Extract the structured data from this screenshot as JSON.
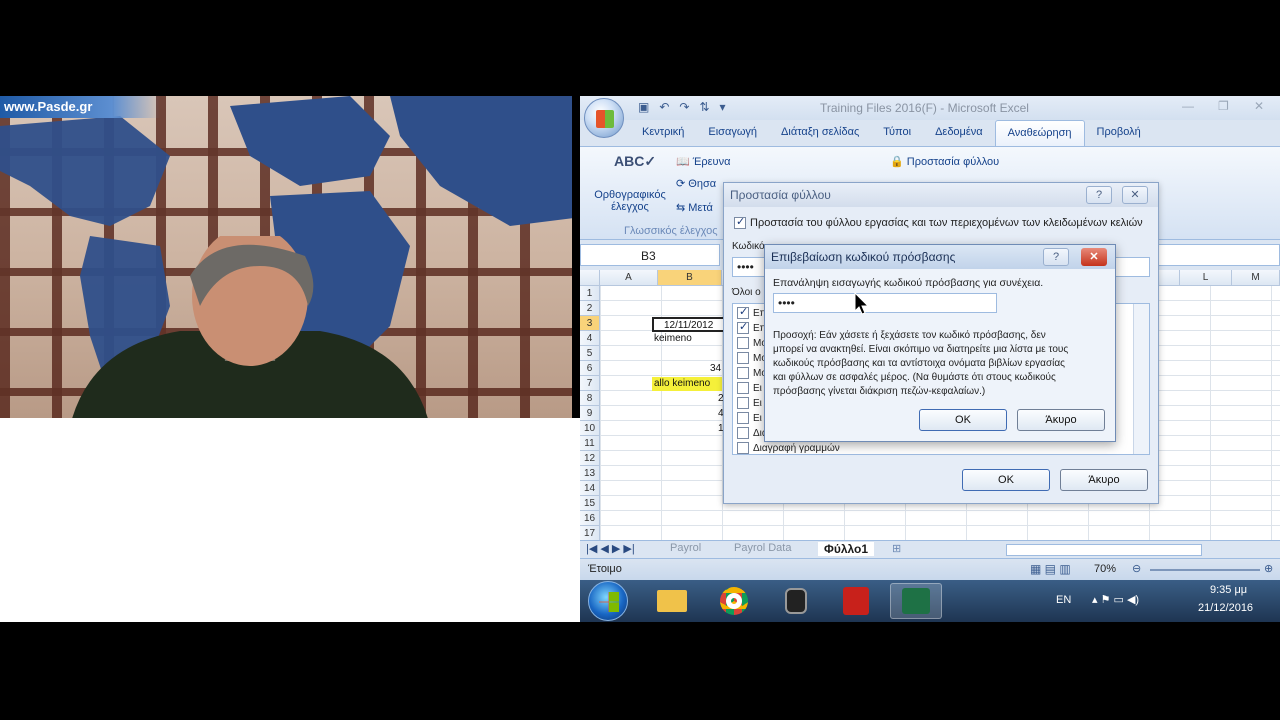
{
  "video": {
    "logo": "www.Pasde.gr"
  },
  "excel": {
    "title": "Training Files 2016(F) - Microsoft Excel",
    "tabs": [
      "Κεντρική",
      "Εισαγωγή",
      "Διάταξη σελίδας",
      "Τύποι",
      "Δεδομένα",
      "Αναθεώρηση",
      "Προβολή"
    ],
    "active_tab": "Αναθεώρηση",
    "ribbon": {
      "spelling": "Ορθογραφικός έλεγχος",
      "research": "Έρευνα",
      "thesaurus": "Θησα",
      "translate": "Μετά",
      "protect_sheet": "Προστασία φύλλου",
      "group_proofing": "Γλωσσικός έλεγχος"
    },
    "name_box": "B3",
    "columns": [
      "A",
      "B",
      "L",
      "M"
    ],
    "rows": [
      "1",
      "2",
      "3",
      "4",
      "5",
      "6",
      "7",
      "8",
      "9",
      "10",
      "11",
      "12",
      "13",
      "14",
      "15",
      "16",
      "17"
    ],
    "cells": {
      "b3": "12/11/2012",
      "b4": "keimeno",
      "b6": "34",
      "b7": "allo keimeno",
      "b8": "2",
      "b9": "4",
      "b10": "1"
    },
    "sheets": [
      "Payrol",
      "Payrol Data",
      "Φύλλο1"
    ],
    "active_sheet": "Φύλλο1",
    "status": "Έτοιμο",
    "zoom": "70%",
    "taskbar": {
      "lang": "EN",
      "time": "9:35 μμ",
      "date": "21/12/2016"
    }
  },
  "dialog_protect": {
    "title": "Προστασία φύλλου",
    "protect_checkbox": "Προστασία του φύλλου εργασίας και των περιεχομένων των κλειδωμένων κελιών",
    "password_label": "Κωδικό",
    "password_value": "••••",
    "allow_label": "Όλοι ο",
    "list_items": [
      "Επ",
      "Επ",
      "Μο",
      "Μο",
      "Μο",
      "Ει",
      "Ει",
      "Ει",
      "Δια",
      "Διαγραφή γραμμών"
    ],
    "ok": "OK",
    "cancel": "Άκυρο"
  },
  "dialog_confirm": {
    "title": "Επιβεβαίωση κωδικού πρόσβασης",
    "prompt": "Επανάληψη εισαγωγής κωδικού πρόσβασης για συνέχεια.",
    "password_value": "••••",
    "warning_lines": [
      "Προσοχή: Εάν χάσετε ή ξεχάσετε τον κωδικό πρόσβασης, δεν",
      "μπορεί να ανακτηθεί. Είναι σκόπιμο να διατηρείτε μια λίστα με τους",
      "κωδικούς πρόσβασης και τα αντίστοιχα ονόματα βιβλίων εργασίας",
      "και φύλλων σε ασφαλές μέρος. (Να θυμάστε ότι στους κωδικούς",
      "πρόσβασης γίνεται διάκριση πεζών-κεφαλαίων.)"
    ],
    "ok": "OK",
    "cancel": "Άκυρο"
  }
}
